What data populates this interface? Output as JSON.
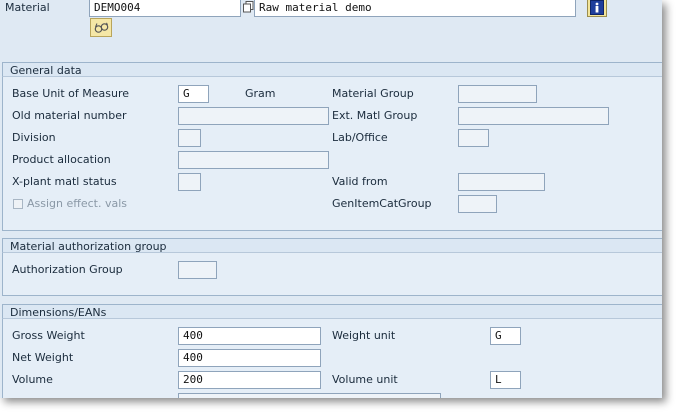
{
  "header": {
    "material_label": "Material",
    "material_value": "DEMO004",
    "description_value": "Raw material demo"
  },
  "general_data": {
    "title": "General data",
    "base_uom_label": "Base Unit of Measure",
    "base_uom_value": "G",
    "base_uom_text": "Gram",
    "material_group_label": "Material Group",
    "material_group_value": "",
    "old_material_number_label": "Old material number",
    "old_material_number_value": "",
    "ext_matl_group_label": "Ext. Matl Group",
    "ext_matl_group_value": "",
    "division_label": "Division",
    "division_value": "",
    "lab_office_label": "Lab/Office",
    "lab_office_value": "",
    "product_allocation_label": "Product allocation",
    "product_allocation_value": "",
    "xplant_status_label": "X-plant matl status",
    "xplant_status_value": "",
    "valid_from_label": "Valid from",
    "valid_from_value": "",
    "assign_effect_vals_label": "Assign effect. vals",
    "gen_item_cat_group_label": "GenItemCatGroup",
    "gen_item_cat_group_value": ""
  },
  "auth_group": {
    "title": "Material authorization group",
    "authorization_group_label": "Authorization Group",
    "authorization_group_value": ""
  },
  "dimensions": {
    "title": "Dimensions/EANs",
    "gross_weight_label": "Gross Weight",
    "gross_weight_value": "400",
    "weight_unit_label": "Weight unit",
    "weight_unit_value": "G",
    "net_weight_label": "Net Weight",
    "net_weight_value": "400",
    "volume_label": "Volume",
    "volume_value": "200",
    "volume_unit_label": "Volume unit",
    "volume_unit_value": "L"
  },
  "icons": {
    "info": "info-icon",
    "glasses": "glasses-icon",
    "copy": "copy-icon"
  },
  "colors": {
    "background": "#dfe9f3",
    "info_button": "#1f3e9c",
    "glasses_button": "#f5e7a6"
  }
}
